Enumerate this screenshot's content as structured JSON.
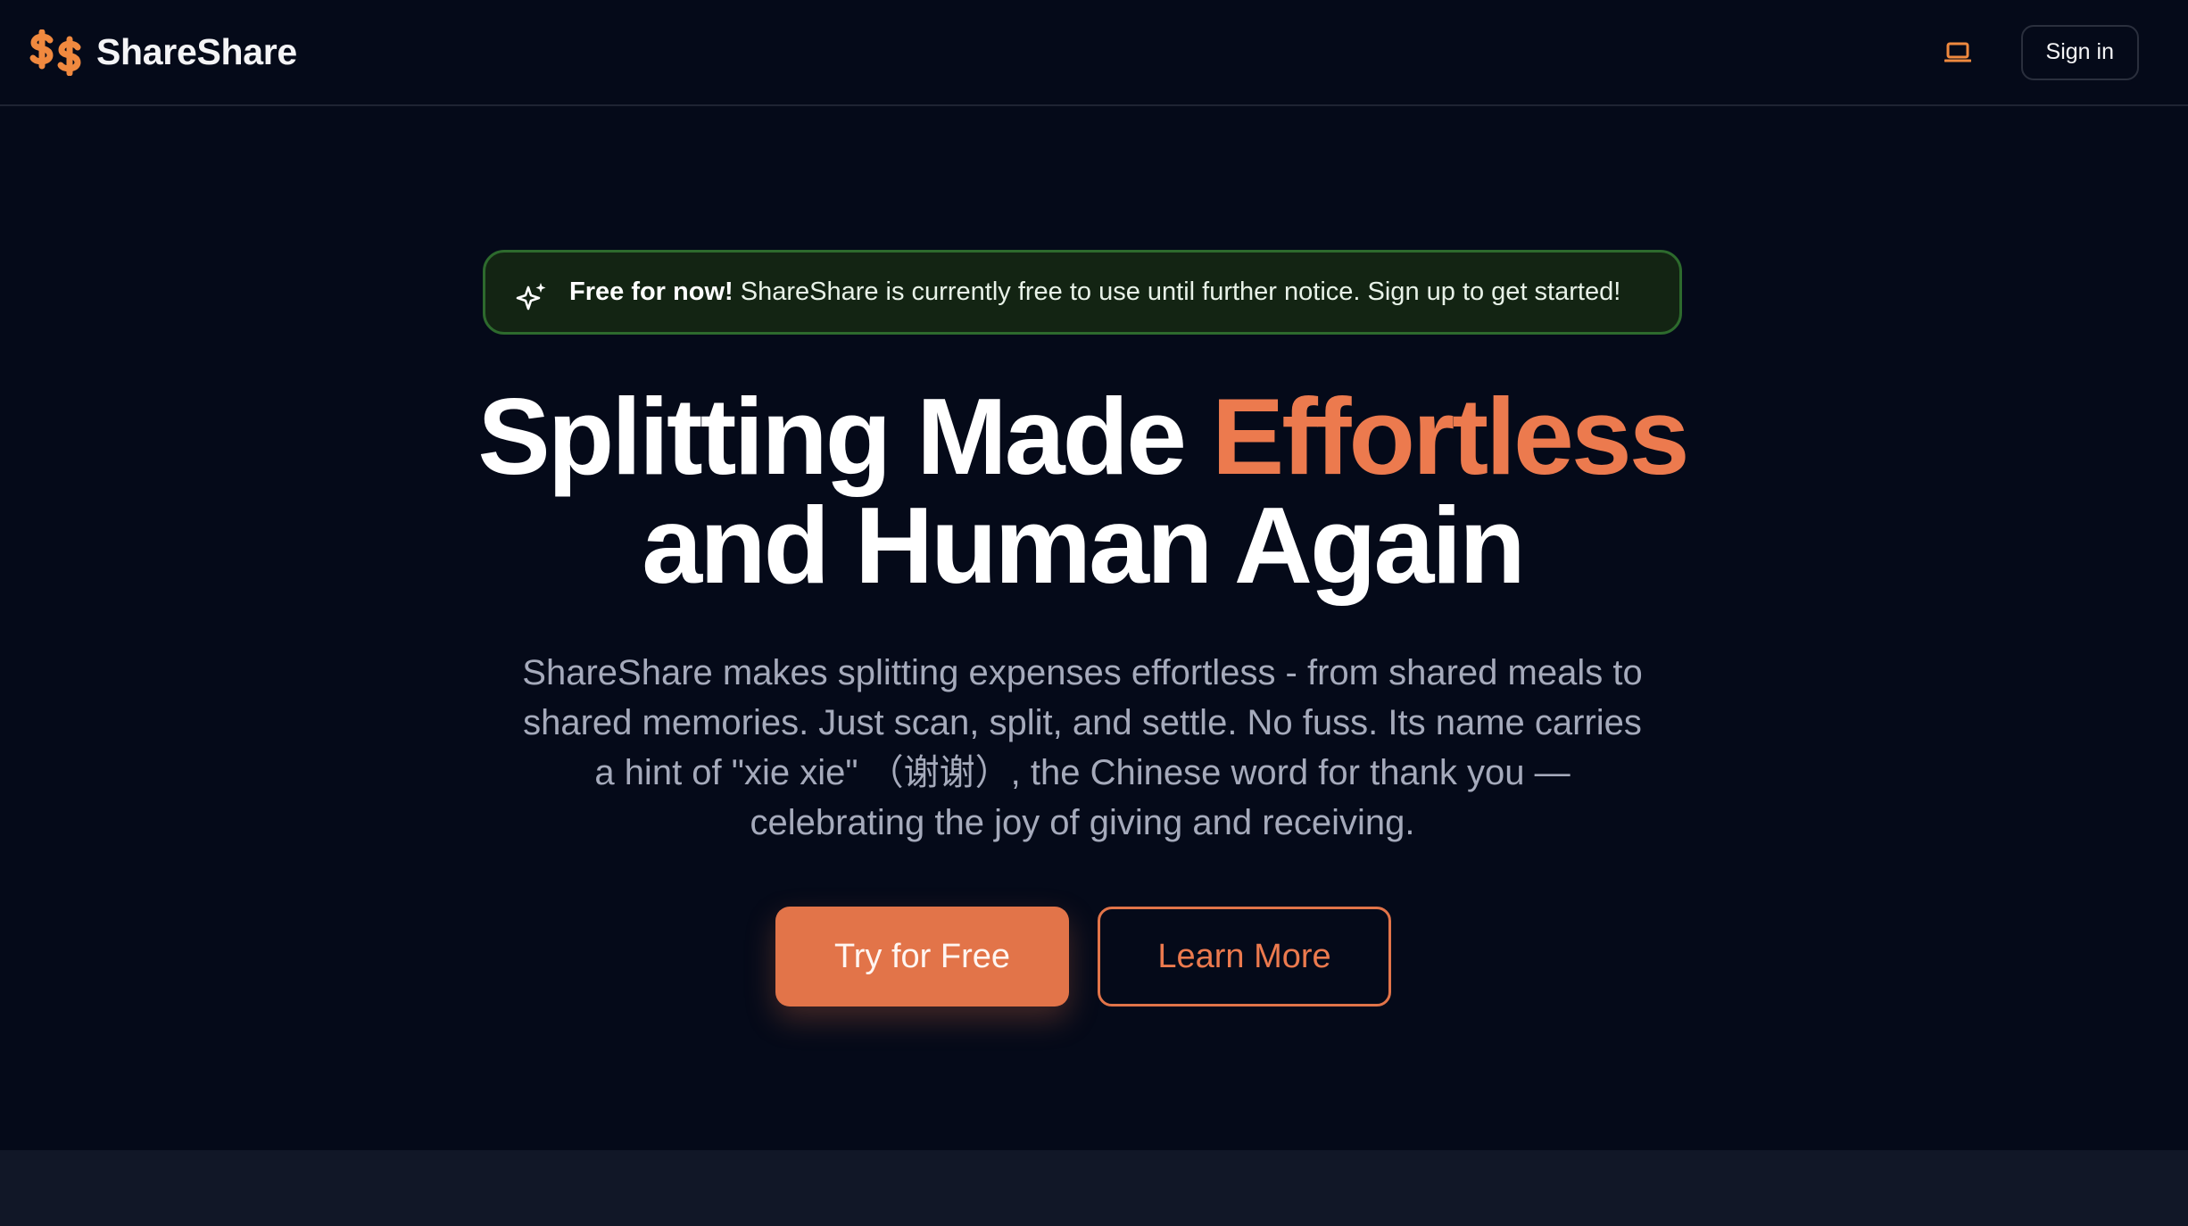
{
  "header": {
    "brand_name": "ShareShare",
    "logo_icon": "dollar-pair-icon",
    "theme_toggle_icon": "laptop-icon",
    "signin_label": "Sign in"
  },
  "notice": {
    "icon": "sparkle-icon",
    "strong": "Free for now!",
    "text": " ShareShare is currently free to use until further notice. Sign up to get started!"
  },
  "hero": {
    "title_part1": "Splitting Made ",
    "title_accent": "Effortless",
    "title_line2": "and Human Again",
    "subtitle_line1": "ShareShare makes splitting expenses effortless - from shared meals to",
    "subtitle_line2": "shared memories. Just scan, split, and settle. No fuss. Its name carries",
    "subtitle_line3": "a hint of \"xie xie\" （谢谢）, the Chinese word for thank you —",
    "subtitle_line4": "celebrating the joy of giving and receiving."
  },
  "cta": {
    "primary_label": "Try for Free",
    "secondary_label": "Learn More"
  },
  "colors": {
    "background": "#050a19",
    "accent": "#e27449",
    "notice_bg": "#132413",
    "notice_border": "#2d6a2d"
  }
}
